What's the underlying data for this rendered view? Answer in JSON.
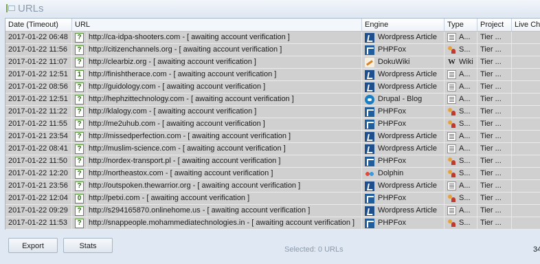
{
  "window": {
    "title": "URLs"
  },
  "columns": [
    "Date (Timeout)",
    "URL",
    "Engine",
    "Type",
    "Project",
    "Live Che"
  ],
  "rows": [
    {
      "date": "2017-01-22 06:48",
      "status": "?",
      "url": "http://ca-idpa-shooters.com - [ awaiting account verification ]",
      "engine": "Wordpress Article",
      "engine_icon": "wordpress-icon",
      "type": "A...",
      "type_icon": "article-icon",
      "project": "Tier ..."
    },
    {
      "date": "2017-01-22 11:56",
      "status": "?",
      "url": "http://citizenchannels.org - [ awaiting account verification ]",
      "engine": "PHPFox",
      "engine_icon": "phpfox-icon",
      "type": "S...",
      "type_icon": "social-icon",
      "project": "Tier ..."
    },
    {
      "date": "2017-01-22 11:07",
      "status": "?",
      "url": "http://clearbiz.org - [ awaiting account verification ]",
      "engine": "DokuWiki",
      "engine_icon": "dokuwiki-icon",
      "type": "Wiki",
      "type_icon": "wiki-icon",
      "project": "Tier ..."
    },
    {
      "date": "2017-01-22 12:51",
      "status": "1",
      "url": "http://finishtherace.com - [ awaiting account verification ]",
      "engine": "Wordpress Article",
      "engine_icon": "wordpress-icon",
      "type": "A...",
      "type_icon": "article-icon",
      "project": "Tier ..."
    },
    {
      "date": "2017-01-22 08:56",
      "status": "?",
      "url": "http://guidology.com - [ awaiting account verification ]",
      "engine": "Wordpress Article",
      "engine_icon": "wordpress-icon",
      "type": "A...",
      "type_icon": "article-icon",
      "project": "Tier ..."
    },
    {
      "date": "2017-01-22 12:51",
      "status": "?",
      "url": "http://hephzittechnology.com - [ awaiting account verification ]",
      "engine": "Drupal - Blog",
      "engine_icon": "drupal-icon",
      "type": "A...",
      "type_icon": "article-icon",
      "project": "Tier ..."
    },
    {
      "date": "2017-01-22 11:22",
      "status": "?",
      "url": "http://klalogy.com - [ awaiting account verification ]",
      "engine": "PHPFox",
      "engine_icon": "phpfox-icon",
      "type": "S...",
      "type_icon": "social-icon",
      "project": "Tier ..."
    },
    {
      "date": "2017-01-22 11:55",
      "status": "?",
      "url": "http://me2uhub.com - [ awaiting account verification ]",
      "engine": "PHPFox",
      "engine_icon": "phpfox-icon",
      "type": "S...",
      "type_icon": "social-icon",
      "project": "Tier ..."
    },
    {
      "date": "2017-01-21 23:54",
      "status": "?",
      "url": "http://missedperfection.com - [ awaiting account verification ]",
      "engine": "Wordpress Article",
      "engine_icon": "wordpress-icon",
      "type": "A...",
      "type_icon": "article-icon",
      "project": "Tier ..."
    },
    {
      "date": "2017-01-22 08:41",
      "status": "?",
      "url": "http://muslim-science.com - [ awaiting account verification ]",
      "engine": "Wordpress Article",
      "engine_icon": "wordpress-icon",
      "type": "A...",
      "type_icon": "article-icon",
      "project": "Tier ..."
    },
    {
      "date": "2017-01-22 11:50",
      "status": "?",
      "url": "http://nordex-transport.pl - [ awaiting account verification ]",
      "engine": "PHPFox",
      "engine_icon": "phpfox-icon",
      "type": "S...",
      "type_icon": "social-icon",
      "project": "Tier ..."
    },
    {
      "date": "2017-01-22 12:20",
      "status": "?",
      "url": "http://northeastox.com - [ awaiting account verification ]",
      "engine": "Dolphin",
      "engine_icon": "dolphin-icon",
      "type": "S...",
      "type_icon": "social-icon",
      "project": "Tier ..."
    },
    {
      "date": "2017-01-21 23:56",
      "status": "?",
      "url": "http://outspoken.thewarrior.org - [ awaiting account verification ]",
      "engine": "Wordpress Article",
      "engine_icon": "wordpress-icon",
      "type": "A...",
      "type_icon": "article-icon",
      "project": "Tier ..."
    },
    {
      "date": "2017-01-22 12:04",
      "status": "0",
      "url": "http://petxi.com - [ awaiting account verification ]",
      "engine": "PHPFox",
      "engine_icon": "phpfox-icon",
      "type": "S...",
      "type_icon": "social-icon",
      "project": "Tier ..."
    },
    {
      "date": "2017-01-22 09:29",
      "status": "?",
      "url": "http://s294165870.onlinehome.us - [ awaiting account verification ]",
      "engine": "Wordpress Article",
      "engine_icon": "wordpress-icon",
      "type": "A...",
      "type_icon": "article-icon",
      "project": "Tier ..."
    },
    {
      "date": "2017-01-22 11:53",
      "status": "?",
      "url": "http://snappeople.mohammediatechnologies.in - [ awaiting account verification ]",
      "engine": "PHPFox",
      "engine_icon": "phpfox-icon",
      "type": "S...",
      "type_icon": "social-icon",
      "project": "Tier ..."
    }
  ],
  "footer": {
    "export_label": "Export",
    "stats_label": "Stats",
    "selected_text": "Selected: 0 URLs",
    "count_text": "34"
  },
  "colors": {
    "row_bg": "#d0d0d0",
    "status_border": "#4e9a2e"
  }
}
